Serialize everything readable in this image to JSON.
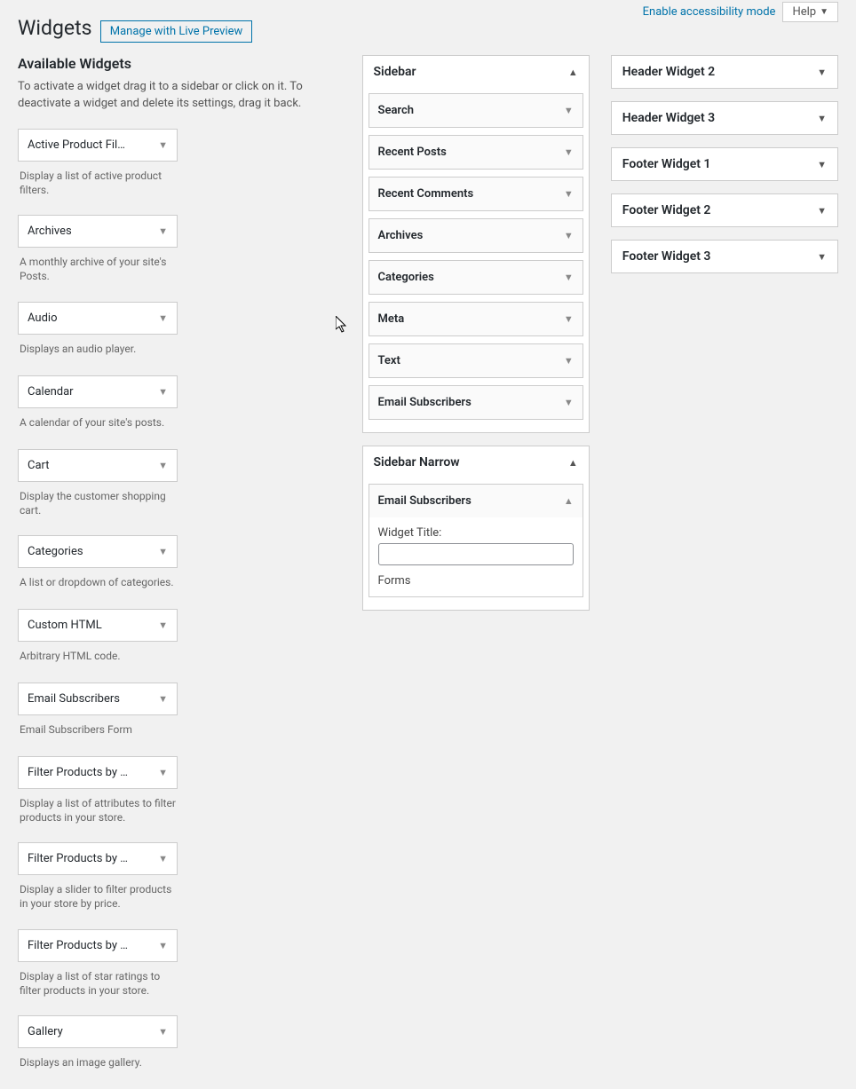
{
  "topbar": {
    "accessibility": "Enable accessibility mode",
    "help": "Help"
  },
  "page": {
    "title": "Widgets",
    "preview_btn": "Manage with Live Preview"
  },
  "available": {
    "heading": "Available Widgets",
    "description": "To activate a widget drag it to a sidebar or click on it. To deactivate a widget and delete its settings, drag it back.",
    "items": [
      {
        "label": "Active Product Fil…",
        "desc": "Display a list of active product filters."
      },
      {
        "label": "Archives",
        "desc": "A monthly archive of your site's Posts."
      },
      {
        "label": "Audio",
        "desc": "Displays an audio player."
      },
      {
        "label": "Calendar",
        "desc": "A calendar of your site's posts."
      },
      {
        "label": "Cart",
        "desc": "Display the customer shopping cart."
      },
      {
        "label": "Categories",
        "desc": "A list or dropdown of categories."
      },
      {
        "label": "Custom HTML",
        "desc": "Arbitrary HTML code."
      },
      {
        "label": "Email Subscribers",
        "desc": "Email Subscribers Form"
      },
      {
        "label": "Filter Products by …",
        "desc": "Display a list of attributes to filter products in your store."
      },
      {
        "label": "Filter Products by …",
        "desc": "Display a slider to filter products in your store by price."
      },
      {
        "label": "Filter Products by …",
        "desc": "Display a list of star ratings to filter products in your store."
      },
      {
        "label": "Gallery",
        "desc": "Displays an image gallery."
      }
    ]
  },
  "areas_mid": [
    {
      "title": "Sidebar",
      "expanded": true,
      "widgets": [
        {
          "label": "Search"
        },
        {
          "label": "Recent Posts"
        },
        {
          "label": "Recent Comments"
        },
        {
          "label": "Archives"
        },
        {
          "label": "Categories"
        },
        {
          "label": "Meta"
        },
        {
          "label": "Text"
        },
        {
          "label": "Email Subscribers"
        }
      ]
    },
    {
      "title": "Sidebar Narrow",
      "expanded": true,
      "widgets": [
        {
          "label": "Email Subscribers",
          "open": true,
          "form": {
            "title_label": "Widget Title:",
            "title_value": "",
            "forms_label": "Forms"
          }
        }
      ]
    }
  ],
  "areas_right": [
    {
      "title": "Header Widget 2"
    },
    {
      "title": "Header Widget 3"
    },
    {
      "title": "Footer Widget 1"
    },
    {
      "title": "Footer Widget 2"
    },
    {
      "title": "Footer Widget 3"
    }
  ]
}
